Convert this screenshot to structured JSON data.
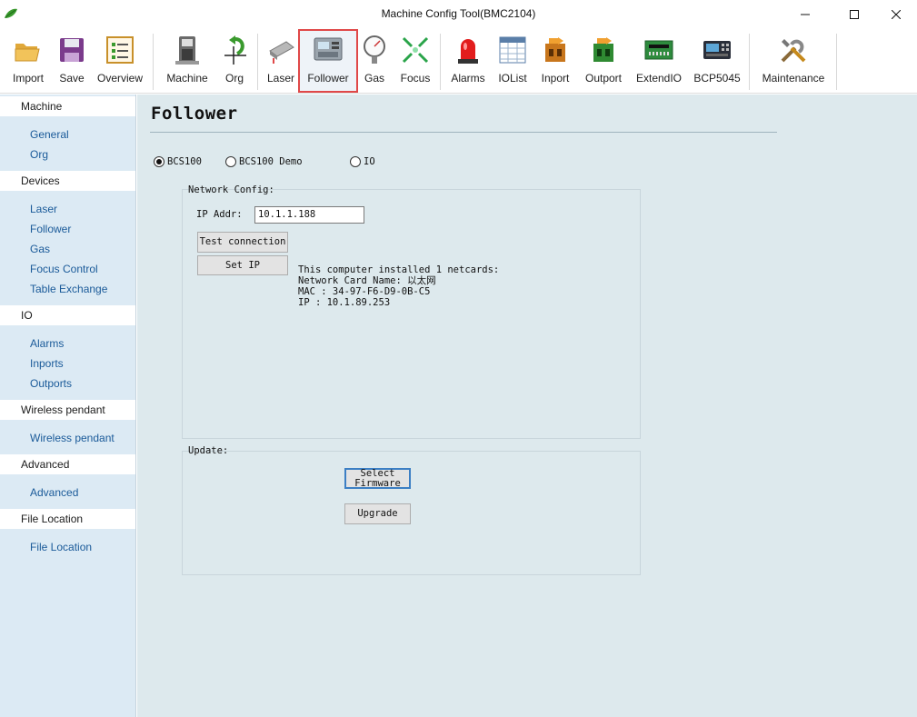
{
  "window": {
    "title": "Machine Config Tool(BMC2104)"
  },
  "toolbar": {
    "items": [
      {
        "label": "Import",
        "icon": "folder-open-icon"
      },
      {
        "label": "Save",
        "icon": "floppy-disk-icon"
      },
      {
        "label": "Overview",
        "icon": "list-checklist-icon"
      },
      {
        "label": "Machine",
        "icon": "machine-icon"
      },
      {
        "label": "Org",
        "icon": "origin-arrow-icon"
      },
      {
        "label": "Laser",
        "icon": "laser-head-icon"
      },
      {
        "label": "Follower",
        "icon": "follower-controller-icon",
        "active": true
      },
      {
        "label": "Gas",
        "icon": "pressure-gauge-icon"
      },
      {
        "label": "Focus",
        "icon": "focus-arrows-icon"
      },
      {
        "label": "Alarms",
        "icon": "alarm-beacon-icon"
      },
      {
        "label": "IOList",
        "icon": "table-grid-icon"
      },
      {
        "label": "Inport",
        "icon": "inport-terminal-icon"
      },
      {
        "label": "Outport",
        "icon": "outport-terminal-icon"
      },
      {
        "label": "ExtendIO",
        "icon": "circuit-board-icon"
      },
      {
        "label": "BCP5045",
        "icon": "control-panel-icon"
      },
      {
        "label": "Maintenance",
        "icon": "tools-icon"
      }
    ]
  },
  "sidebar": {
    "sections": [
      {
        "title": "Machine",
        "items": [
          "General",
          "Org"
        ]
      },
      {
        "title": "Devices",
        "items": [
          "Laser",
          "Follower",
          "Gas",
          "Focus Control",
          "Table Exchange"
        ]
      },
      {
        "title": "IO",
        "items": [
          "Alarms",
          "Inports",
          "Outports"
        ]
      },
      {
        "title": "Wireless pendant",
        "items": [
          "Wireless pendant"
        ]
      },
      {
        "title": "Advanced",
        "items": [
          "Advanced"
        ]
      },
      {
        "title": "File Location",
        "items": [
          "File Location"
        ]
      }
    ]
  },
  "main": {
    "title": "Follower",
    "radios": [
      {
        "label": "BCS100",
        "checked": true
      },
      {
        "label": "BCS100 Demo",
        "checked": false
      },
      {
        "label": "IO",
        "checked": false
      }
    ],
    "network": {
      "group_label": "Network Config:",
      "ip_label": "IP Addr:",
      "ip_value": "10.1.1.188",
      "test_button": "Test connection",
      "setip_button": "Set IP",
      "info": [
        "This computer installed 1 netcards:",
        "Network Card Name: 以太网",
        "MAC : 34-97-F6-D9-0B-C5",
        "IP : 10.1.89.253"
      ]
    },
    "update": {
      "group_label": "Update:",
      "select_firmware_line1": "Select",
      "select_firmware_line2": "Firmware",
      "upgrade_button": "Upgrade"
    }
  },
  "colors": {
    "sidebar_bg": "#dceaf4",
    "main_bg": "#dde9ed",
    "link": "#1a5a99",
    "active_outline": "#e04848"
  }
}
